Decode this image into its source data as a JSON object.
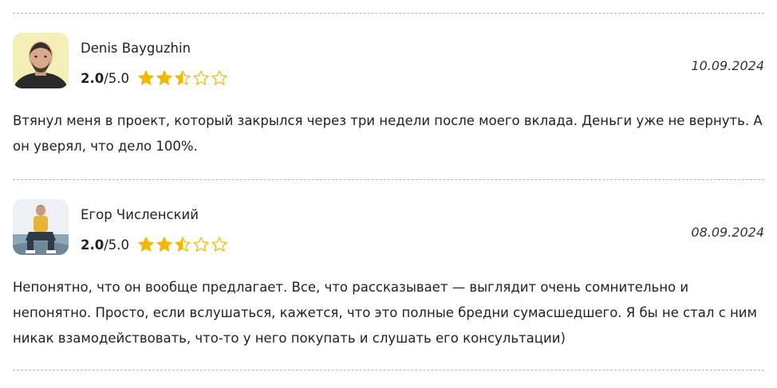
{
  "reviews": [
    {
      "author": "Denis Bayguzhin",
      "score": "2.0",
      "score_max": "/5.0",
      "stars": 2.5,
      "date": "10.09.2024",
      "text": "Втянул меня в проект, который закрылся через три недели после моего вклада. Деньги уже не вернуть. А он уверял, что дело 100%."
    },
    {
      "author": "Егор Численский",
      "score": "2.0",
      "score_max": "/5.0",
      "stars": 2.5,
      "date": "08.09.2024",
      "text": "Непонятно, что он вообще предлагает. Все, что рассказывает — выглядит очень сомнительно и непонятно. Просто, если вслушаться, кажется, что это полные бредни сумасшедшего. Я бы не стал с ним никак взамодействовать, что-то у него покупать и слушать его консультации)"
    }
  ],
  "colors": {
    "star": "#f5b800",
    "divider": "#b5b5b5"
  },
  "icons": [
    "star-icon",
    "avatar"
  ]
}
